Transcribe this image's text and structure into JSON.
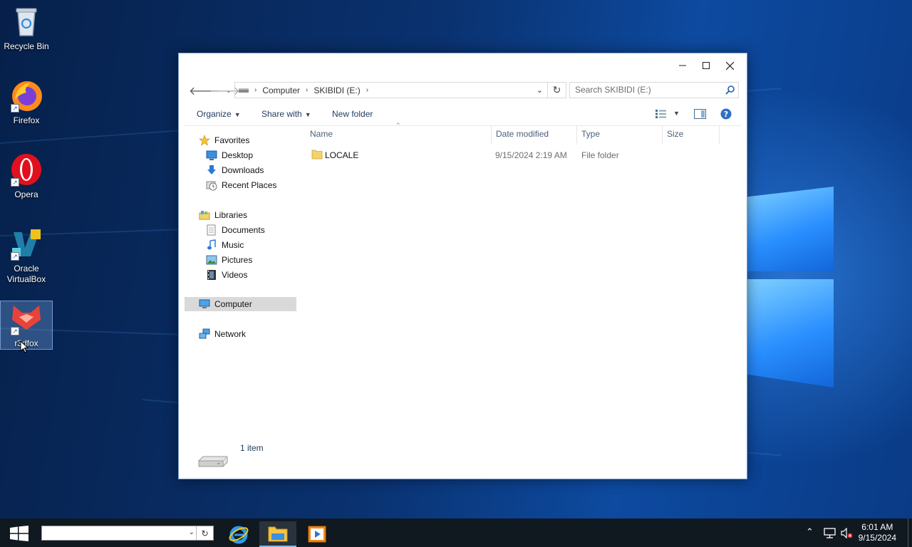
{
  "desktop": {
    "icons": [
      {
        "label": "Recycle Bin"
      },
      {
        "label": "Firefox"
      },
      {
        "label": "Opera"
      },
      {
        "label": "Oracle VirtualBox"
      },
      {
        "label": "r3dfox"
      }
    ]
  },
  "window": {
    "address": {
      "crumbs": [
        "Computer",
        "SKIBIDI (E:)"
      ],
      "search_placeholder": "Search SKIBIDI (E:)"
    },
    "toolbar": {
      "organize": "Organize",
      "share_with": "Share with",
      "new_folder": "New folder"
    },
    "nav": {
      "favorites": "Favorites",
      "desktop": "Desktop",
      "downloads": "Downloads",
      "recent_places": "Recent Places",
      "libraries": "Libraries",
      "documents": "Documents",
      "music": "Music",
      "pictures": "Pictures",
      "videos": "Videos",
      "computer": "Computer",
      "network": "Network"
    },
    "columns": {
      "name": "Name",
      "date_modified": "Date modified",
      "type": "Type",
      "size": "Size"
    },
    "files": [
      {
        "name": "LOCALE",
        "date_modified": "9/15/2024 2:19 AM",
        "type": "File folder",
        "size": ""
      }
    ],
    "status": "1 item"
  },
  "taskbar": {
    "clock_time": "6:01 AM",
    "clock_date": "9/15/2024"
  },
  "colors": {
    "accent": "#76b9ed",
    "folder": "#f4d36b",
    "selection": "#d9d9d9"
  }
}
